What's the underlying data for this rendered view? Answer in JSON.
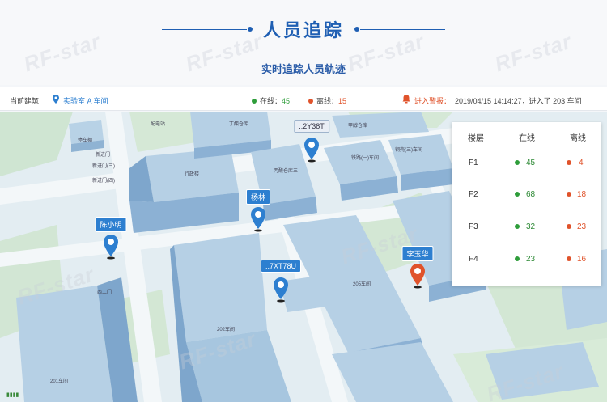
{
  "header": {
    "title": "人员追踪",
    "subtitle": "实时追踪人员轨迹"
  },
  "infobar": {
    "building_label": "当前建筑",
    "building_value": "实验室 A 车间",
    "online_label": "在线：",
    "online_value": "45",
    "offline_label": "离线：",
    "offline_value": "15",
    "alarm_label": "进入警报：",
    "alarm_text": "2019/04/15  14:14:27，进入了 203 车间"
  },
  "floor_table": {
    "headers": [
      "楼层",
      "在线",
      "离线"
    ],
    "rows": [
      {
        "floor": "F1",
        "online": "45",
        "offline": "4"
      },
      {
        "floor": "F2",
        "online": "68",
        "offline": "18"
      },
      {
        "floor": "F3",
        "online": "32",
        "offline": "23"
      },
      {
        "floor": "F4",
        "online": "23",
        "offline": "16"
      }
    ]
  },
  "markers": [
    {
      "label": "..2Y38T",
      "color": "#2d7fd0"
    },
    {
      "label": "杨林",
      "color": "#2d7fd0"
    },
    {
      "label": "陈小明",
      "color": "#2d7fd0"
    },
    {
      "label": "..7XT78U",
      "color": "#2d7fd0"
    },
    {
      "label": "李玉华",
      "color": "#e0532b"
    }
  ],
  "map_labels": {
    "l1": "停车棚",
    "l2": "行政楼",
    "l3": "丁酸仓库",
    "l4": "丙酸仓库三",
    "l5": "甲醇仓库",
    "l6": "铁路(一)车间",
    "l7": "钢壳(三)车间",
    "l8": "205车间",
    "l9": "202车间",
    "l10": "201车间",
    "l11": "配电站",
    "l12": "新进门",
    "l13": "新进门(三)",
    "l14": "新进门(四)",
    "l15": "西二门"
  },
  "watermark": "RF-star",
  "colors": {
    "brand_blue": "#1f5fb3",
    "online_green": "#2e9d3a",
    "offline_red": "#e0532b"
  }
}
